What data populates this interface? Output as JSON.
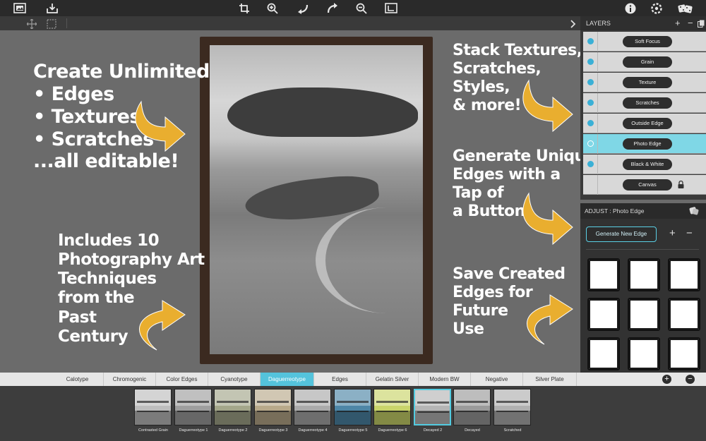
{
  "toolbar": {
    "icons": [
      "photo-library-icon",
      "import-icon",
      "crop-icon",
      "zoom-in-icon",
      "undo-icon",
      "redo-icon",
      "zoom-out-icon",
      "fit-screen-icon",
      "info-icon",
      "settings-icon",
      "randomize-dice-icon"
    ],
    "sub_icons": [
      "move-icon",
      "select-icon",
      "chevron-right-icon"
    ]
  },
  "annotations": {
    "left_top": [
      "Create Unlimited",
      "• Edges",
      "• Textures",
      "• Scratches",
      "...all editable!"
    ],
    "left_bottom": [
      "Includes 10",
      "Photography Art",
      "Techniques",
      "from the",
      "Past",
      "Century"
    ],
    "right_top": [
      "Stack Textures,",
      "Scratches,",
      "Styles,",
      "& more!"
    ],
    "right_mid": [
      "Generate Unique",
      "Edges with a",
      "Tap of",
      "a Button"
    ],
    "right_bottom": [
      "Save Created",
      "Edges for",
      "Future",
      "Use"
    ]
  },
  "layers_panel": {
    "title": "LAYERS",
    "add_label": "+",
    "remove_label": "−",
    "items": [
      {
        "label": "Soft Focus"
      },
      {
        "label": "Grain"
      },
      {
        "label": "Texture"
      },
      {
        "label": "Scratches"
      },
      {
        "label": "Outside Edge"
      },
      {
        "label": "Photo Edge",
        "selected": true
      },
      {
        "label": "Black & White"
      },
      {
        "label": "Canvas",
        "locked": true
      }
    ]
  },
  "adjust_panel": {
    "title": "ADJUST : Photo Edge",
    "generate_label": "Generate New Edge",
    "add_label": "+",
    "remove_label": "−"
  },
  "style_tabs": {
    "items": [
      "Calotype",
      "Chromogenic",
      "Color Edges",
      "Cyanotype",
      "Daguerreotype",
      "Edges",
      "Gelatin Silver",
      "Modern BW",
      "Negative",
      "Silver Plate"
    ],
    "selected": "Daguerreotype",
    "add_label": "+",
    "remove_label": "−"
  },
  "presets": {
    "items": [
      "Contrasted Grain",
      "Daguerreotype 1",
      "Daguerreotype 2",
      "Daguerreotype 3",
      "Daguerreotype 4",
      "Daguerreotype 5",
      "Daguerreotype 6",
      "Decayed 2",
      "Decayed",
      "Scratched"
    ],
    "selected": "Decayed 2",
    "tints": [
      "#bdbdbd",
      "#9e9e9e",
      "#a3a68a",
      "#b8a98a",
      "#aaaaaa",
      "#4e86a6",
      "#c9d46a",
      "#b5b5b5",
      "#9a9a9a",
      "#b0b0b0"
    ]
  },
  "colors": {
    "accent": "#54c3dc",
    "arrow": "#e9ae2f",
    "background": "#6b6b6b"
  }
}
